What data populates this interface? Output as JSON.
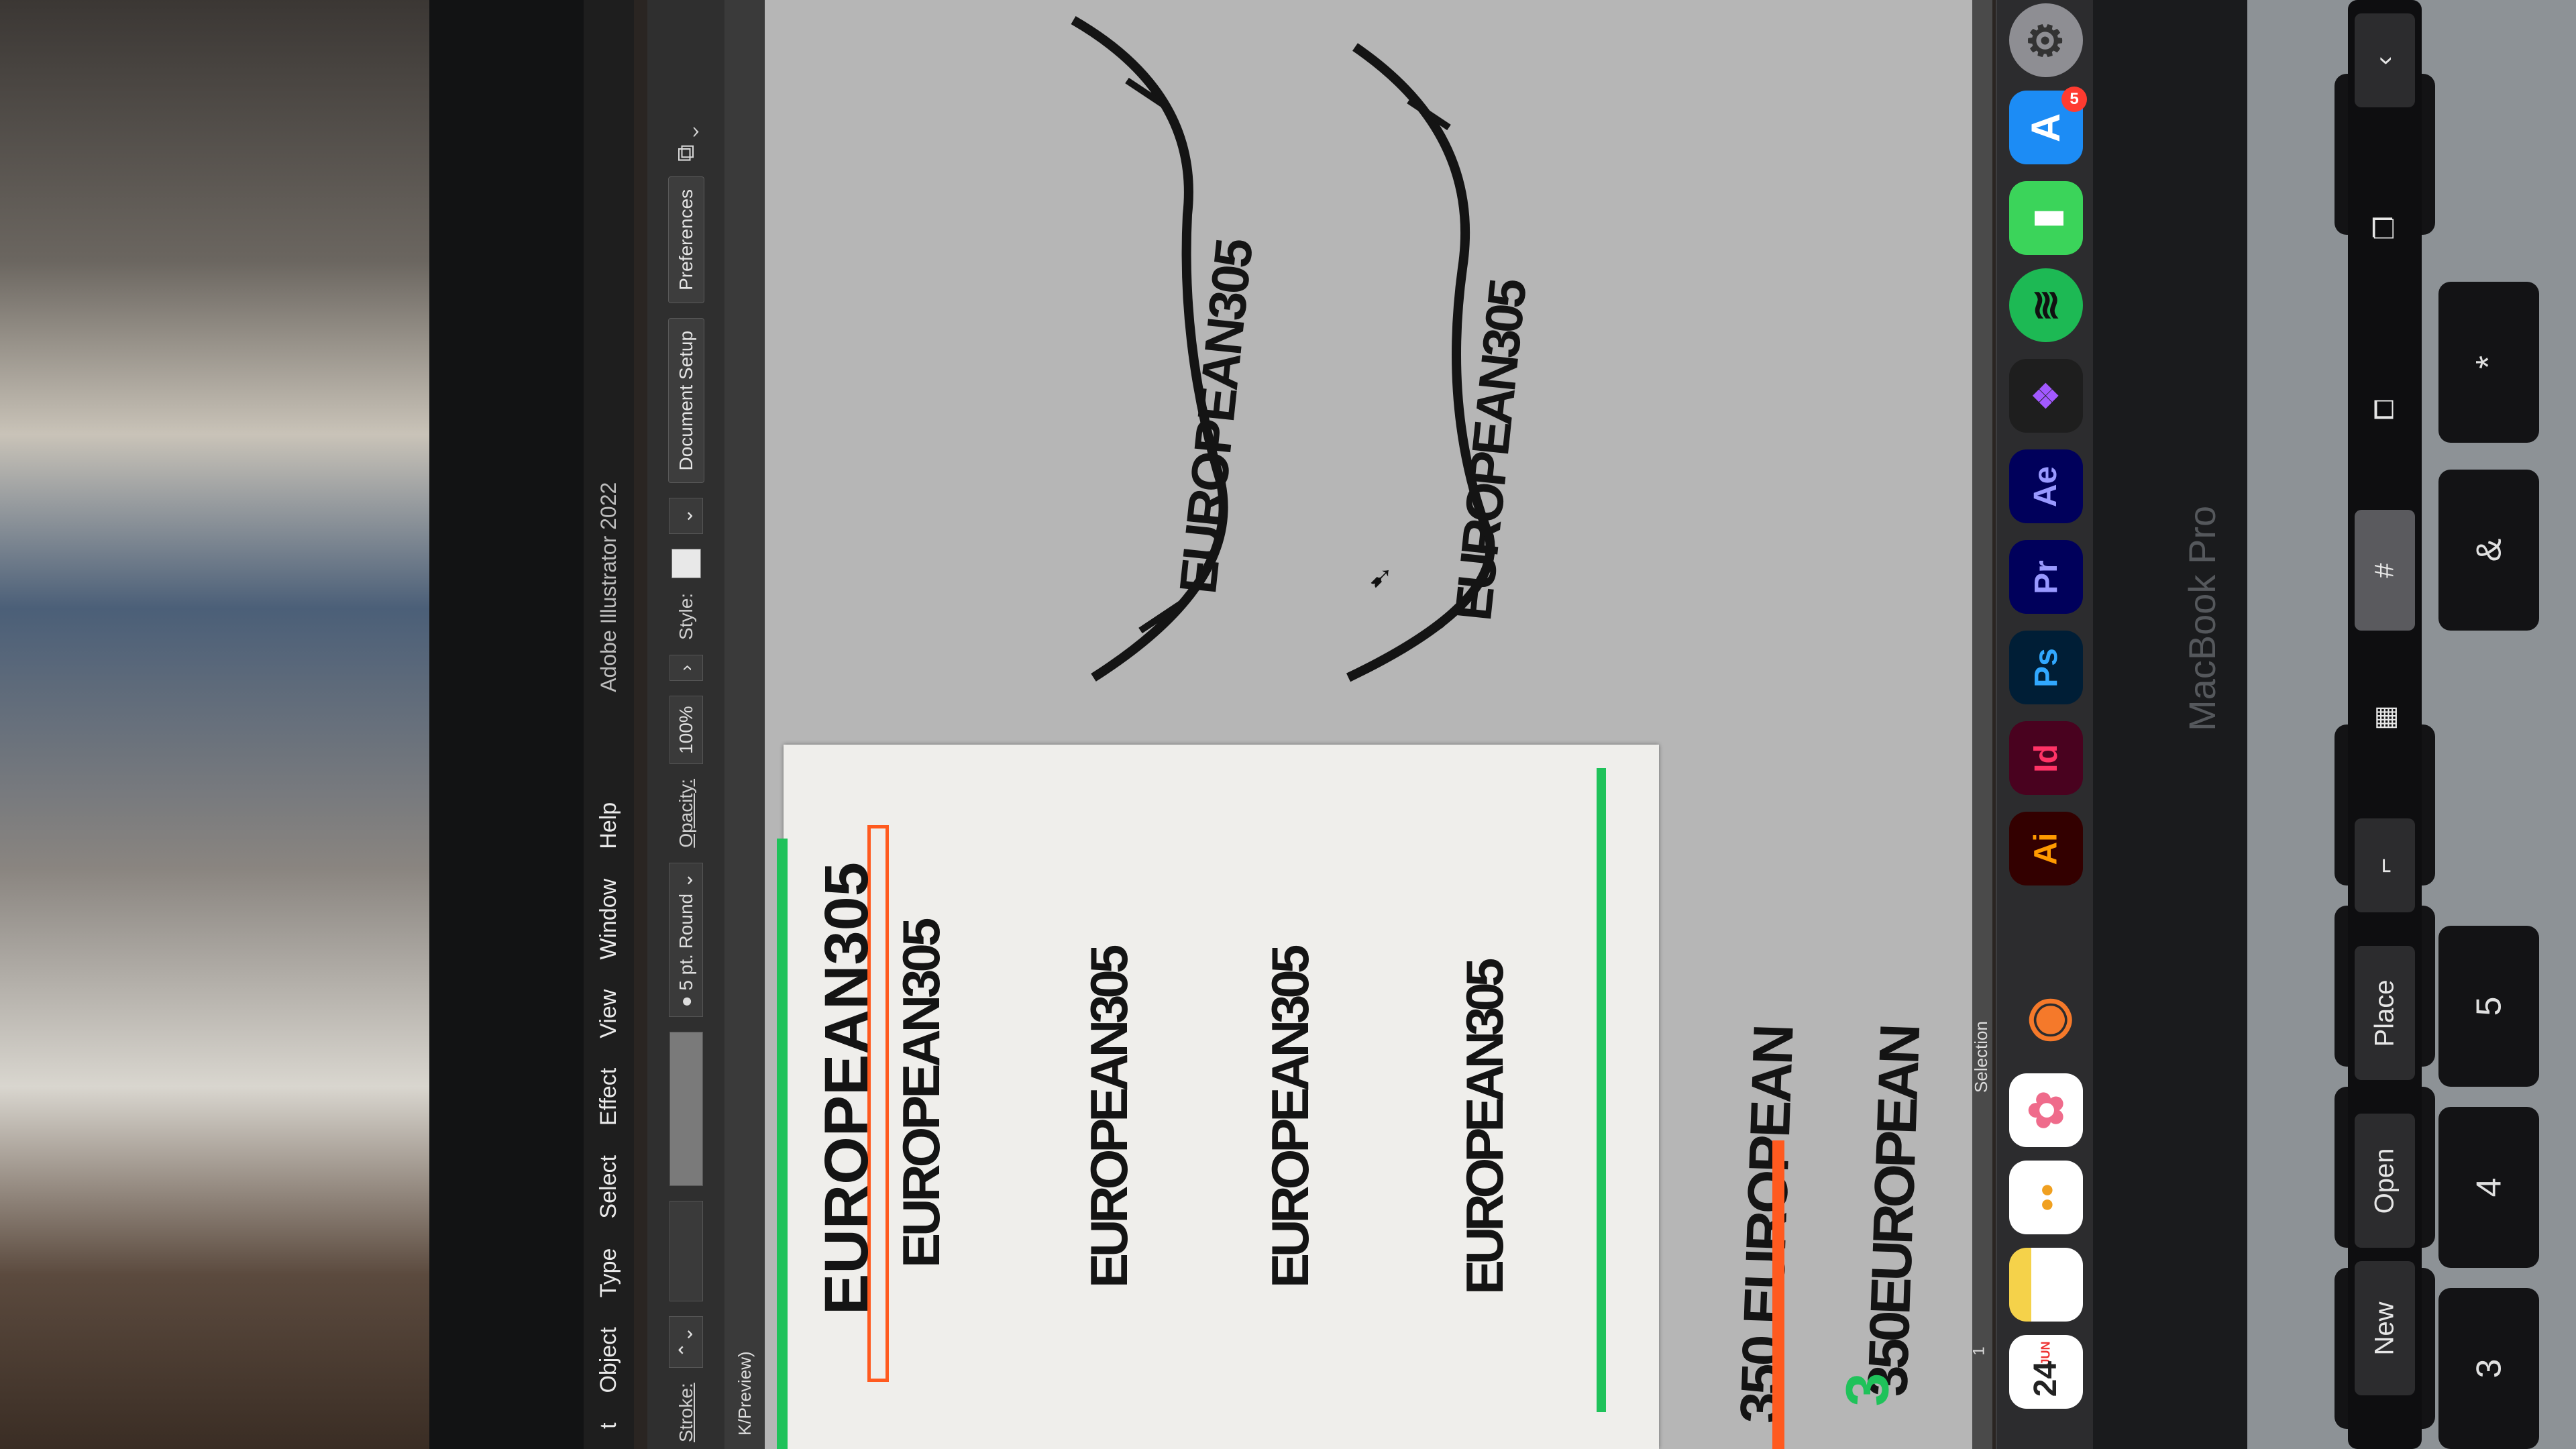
{
  "window": {
    "app_title": "Adobe Illustrator 2022",
    "document_tab": "K/Preview)"
  },
  "menu": {
    "items": [
      "t",
      "Object",
      "Type",
      "Select",
      "Effect",
      "View",
      "Window",
      "Help"
    ]
  },
  "control_bar": {
    "stroke_label": "Stroke:",
    "brush_value": "5 pt. Round",
    "opacity_label": "Opacity:",
    "opacity_value": "100%",
    "style_label": "Style:",
    "document_setup": "Document Setup",
    "preferences": "Preferences"
  },
  "canvas": {
    "artboard_heading": "EUROPEAN305",
    "logo_text": "EUROPEAN305",
    "bottom_logo_1": "350 EUROPEAN",
    "bottom_logo_2": "350EUROPEAN"
  },
  "status": {
    "zoom": "1",
    "tool": "Selection"
  },
  "dock": {
    "calendar_month": "JUN",
    "calendar_day": "24",
    "appstore_badge": "5",
    "apps": [
      {
        "name": "Calendar"
      },
      {
        "name": "Notes"
      },
      {
        "name": "Reminders"
      },
      {
        "name": "Photos"
      },
      {
        "name": "Blender"
      },
      {
        "name": "Illustrator",
        "label": "Ai"
      },
      {
        "name": "InDesign",
        "label": "Id"
      },
      {
        "name": "Photoshop",
        "label": "Ps"
      },
      {
        "name": "Premiere Pro",
        "label": "Pr"
      },
      {
        "name": "After Effects",
        "label": "Ae"
      },
      {
        "name": "Figma"
      },
      {
        "name": "Spotify"
      },
      {
        "name": "Facetime"
      },
      {
        "name": "App Store"
      },
      {
        "name": "System Preferences"
      }
    ]
  },
  "hardware": {
    "label": "MacBook Pro"
  },
  "touchbar": {
    "keys": [
      "New",
      "Open",
      "Place"
    ]
  },
  "keyboard": {
    "keys": [
      "3",
      "4",
      "5",
      "&",
      "*",
      "£ #",
      "$",
      "%",
      "^",
      "("
    ]
  },
  "colors": {
    "guide_green": "#1fc25a",
    "guide_orange": "#ff5a1f",
    "canvas_grey": "#b6b6b6"
  }
}
